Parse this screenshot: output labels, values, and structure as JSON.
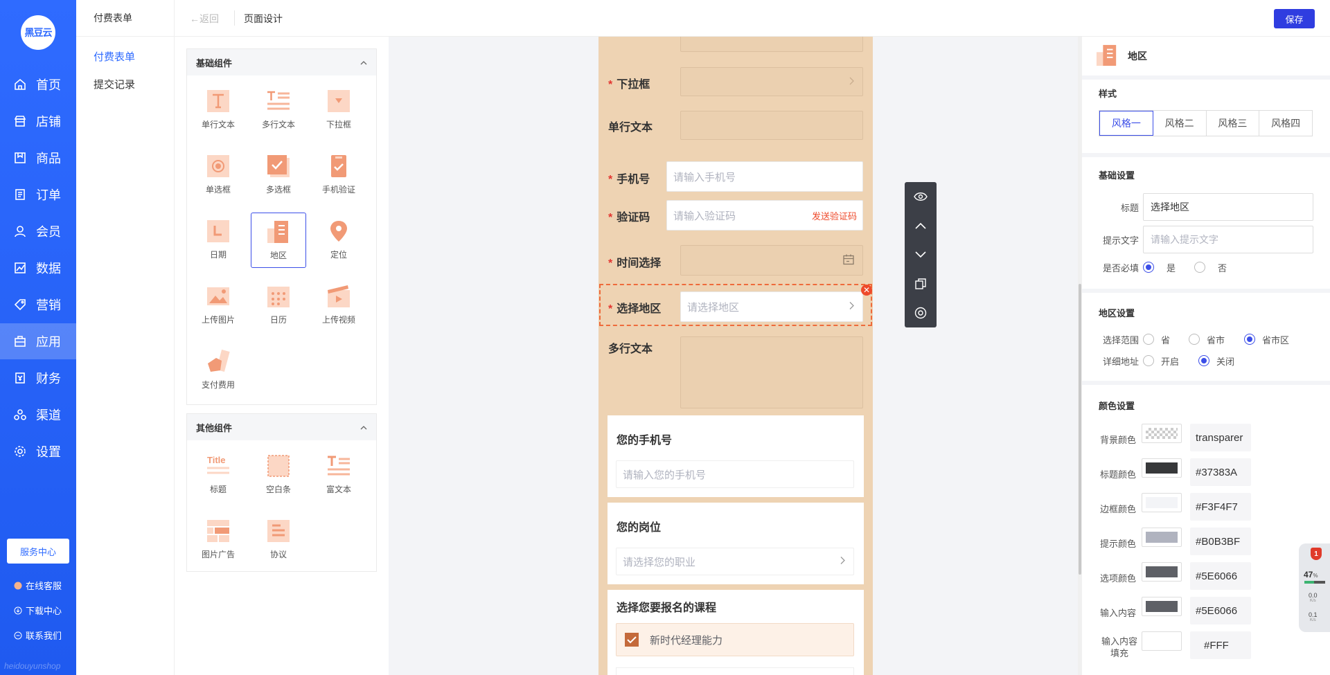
{
  "nav": {
    "logo": "黑豆云",
    "items": [
      {
        "label": "首页",
        "icon": "home-icon"
      },
      {
        "label": "店铺",
        "icon": "store-icon"
      },
      {
        "label": "商品",
        "icon": "goods-icon"
      },
      {
        "label": "订单",
        "icon": "order-icon"
      },
      {
        "label": "会员",
        "icon": "user-icon"
      },
      {
        "label": "数据",
        "icon": "chart-icon"
      },
      {
        "label": "营销",
        "icon": "tag-icon"
      },
      {
        "label": "应用",
        "icon": "app-icon"
      },
      {
        "label": "财务",
        "icon": "finance-icon"
      },
      {
        "label": "渠道",
        "icon": "channel-icon"
      },
      {
        "label": "设置",
        "icon": "gear-icon"
      }
    ],
    "active_index": 7,
    "service_center": "服务中心",
    "links": [
      "在线客服",
      "下载中心",
      "联系我们"
    ],
    "watermark": "heidouyunshop"
  },
  "submenu": {
    "title": "付费表单",
    "items": [
      "付费表单",
      "提交记录"
    ]
  },
  "topbar": {
    "back": "返回",
    "title": "页面设计",
    "save": "保存"
  },
  "components": {
    "basic_title": "基础组件",
    "basic": [
      "单行文本",
      "多行文本",
      "下拉框",
      "单选框",
      "多选框",
      "手机验证",
      "日期",
      "地区",
      "定位",
      "上传图片",
      "日历",
      "上传视频",
      "支付费用"
    ],
    "selected": "地区",
    "other_title": "其他组件",
    "other": [
      "标题",
      "空白条",
      "富文本",
      "图片广告",
      "协议"
    ]
  },
  "form": {
    "dropdown": "下拉框",
    "single_text": "单行文本",
    "phone": "手机号",
    "phone_ph": "请输入手机号",
    "code": "验证码",
    "code_ph": "请输入验证码",
    "send_code": "发送验证码",
    "time": "时间选择",
    "region": "选择地区",
    "region_ph": "请选择地区",
    "multi_text": "多行文本",
    "card1_title": "您的手机号",
    "card1_ph": "请输入您的手机号",
    "card2_title": "您的岗位",
    "card2_ph": "请选择您的职业",
    "card3_title": "选择您要报名的课程",
    "card3_option": "新时代经理能力",
    "close": "✕"
  },
  "settings": {
    "header": "地区",
    "style_title": "样式",
    "styles": [
      "风格一",
      "风格二",
      "风格三",
      "风格四"
    ],
    "basic_title": "基础设置",
    "title_label": "标题",
    "title_value": "选择地区",
    "hint_label": "提示文字",
    "hint_ph": "请输入提示文字",
    "required_label": "是否必填",
    "yes": "是",
    "no": "否",
    "region_title": "地区设置",
    "range_label": "选择范围",
    "range_opts": [
      "省",
      "省市",
      "省市区"
    ],
    "detail_label": "详细地址",
    "detail_opts": [
      "开启",
      "关闭"
    ],
    "color_title": "颜色设置",
    "colors": [
      {
        "label": "背景颜色",
        "value": "transparer",
        "swatch": "transparent"
      },
      {
        "label": "标题颜色",
        "value": "#37383A",
        "swatch": "#37383A"
      },
      {
        "label": "边框颜色",
        "value": "#F3F4F7",
        "swatch": "#F3F4F7"
      },
      {
        "label": "提示颜色",
        "value": "#B0B3BF",
        "swatch": "#B0B3BF"
      },
      {
        "label": "选项颜色",
        "value": "#5E6066",
        "swatch": "#5E6066"
      },
      {
        "label": "输入内容",
        "value": "#5E6066",
        "swatch": "#5E6066"
      },
      {
        "label": "输入内容填充",
        "value": "#FFF",
        "swatch": "#FFFFFF"
      }
    ]
  },
  "netwidget": {
    "badge": "1",
    "percent": "47",
    "unit": "%",
    "up": "0.0",
    "up_unit": "K/s",
    "down": "0.1",
    "down_unit": "K/s"
  },
  "accent": "#2f3de0"
}
